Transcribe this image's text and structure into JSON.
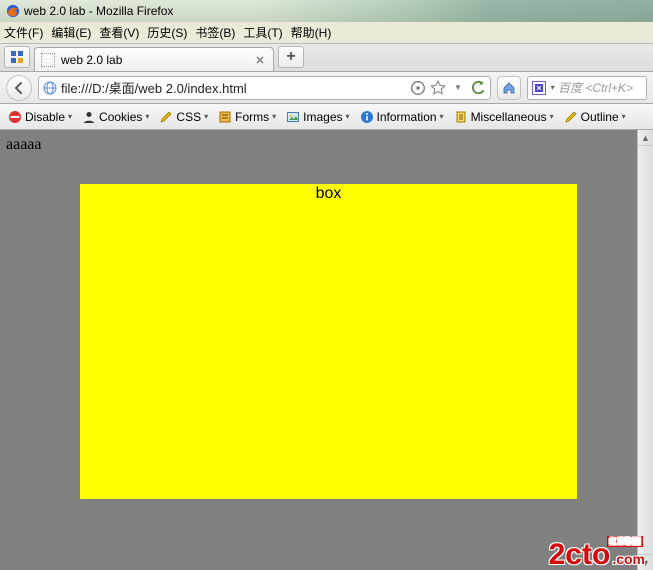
{
  "window": {
    "title": "web 2.0 lab - Mozilla Firefox"
  },
  "menu": {
    "file": "文件(F)",
    "edit": "编辑(E)",
    "view": "查看(V)",
    "history": "历史(S)",
    "bookmarks": "书签(B)",
    "tools": "工具(T)",
    "help": "帮助(H)"
  },
  "tabs": {
    "active": {
      "title": "web 2.0 lab"
    },
    "new_tab_glyph": "+"
  },
  "nav": {
    "url": "file:///D:/桌面/web 2.0/index.html",
    "search_placeholder": "百度 <Ctrl+K>"
  },
  "devbar": {
    "disable": "Disable",
    "cookies": "Cookies",
    "css": "CSS",
    "forms": "Forms",
    "images": "Images",
    "information": "Information",
    "miscellaneous": "Miscellaneous",
    "outline": "Outline"
  },
  "page": {
    "body_text": "aaaaa",
    "box_label": "box"
  },
  "watermark": {
    "main": "2cto",
    "tld": ".com",
    "cn": "红果联盟"
  }
}
